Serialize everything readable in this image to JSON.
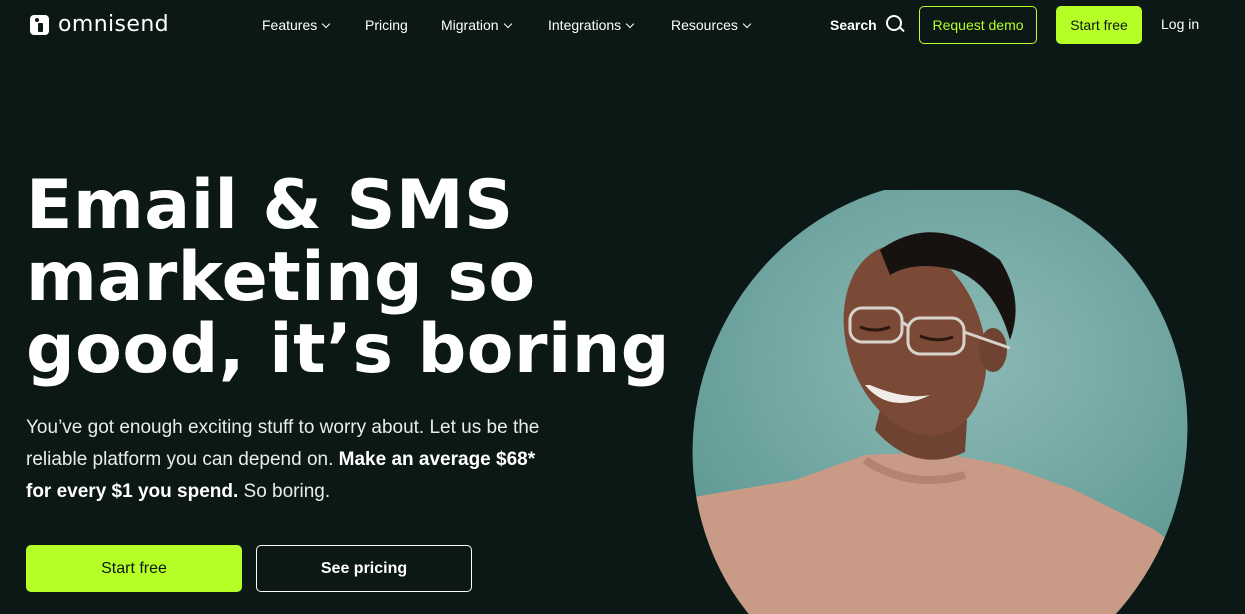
{
  "nav": {
    "logo_text": "omnisend",
    "items": [
      {
        "label": "Features",
        "dropdown": true
      },
      {
        "label": "Pricing",
        "dropdown": false
      },
      {
        "label": "Migration",
        "dropdown": true
      },
      {
        "label": "Integrations",
        "dropdown": true
      },
      {
        "label": "Resources",
        "dropdown": true
      }
    ],
    "search_label": "Search",
    "request_demo": "Request demo",
    "start_free": "Start free",
    "log_in": "Log in"
  },
  "hero": {
    "title_lines": [
      "Email & SMS",
      "marketing so",
      "good, it’s boring"
    ],
    "subtitle_plain": "You’ve got enough exciting stuff to worry about. Let us be the reliable platform you can depend on. ",
    "subtitle_bold": "Make an average $68* for every $1 you spend.",
    "subtitle_end": " So boring.",
    "cta_primary": "Start free",
    "cta_secondary": "See pricing"
  },
  "colors": {
    "background": "#0b1815",
    "accent": "#b5ff26",
    "image_backdrop": "#6fa7a2"
  }
}
